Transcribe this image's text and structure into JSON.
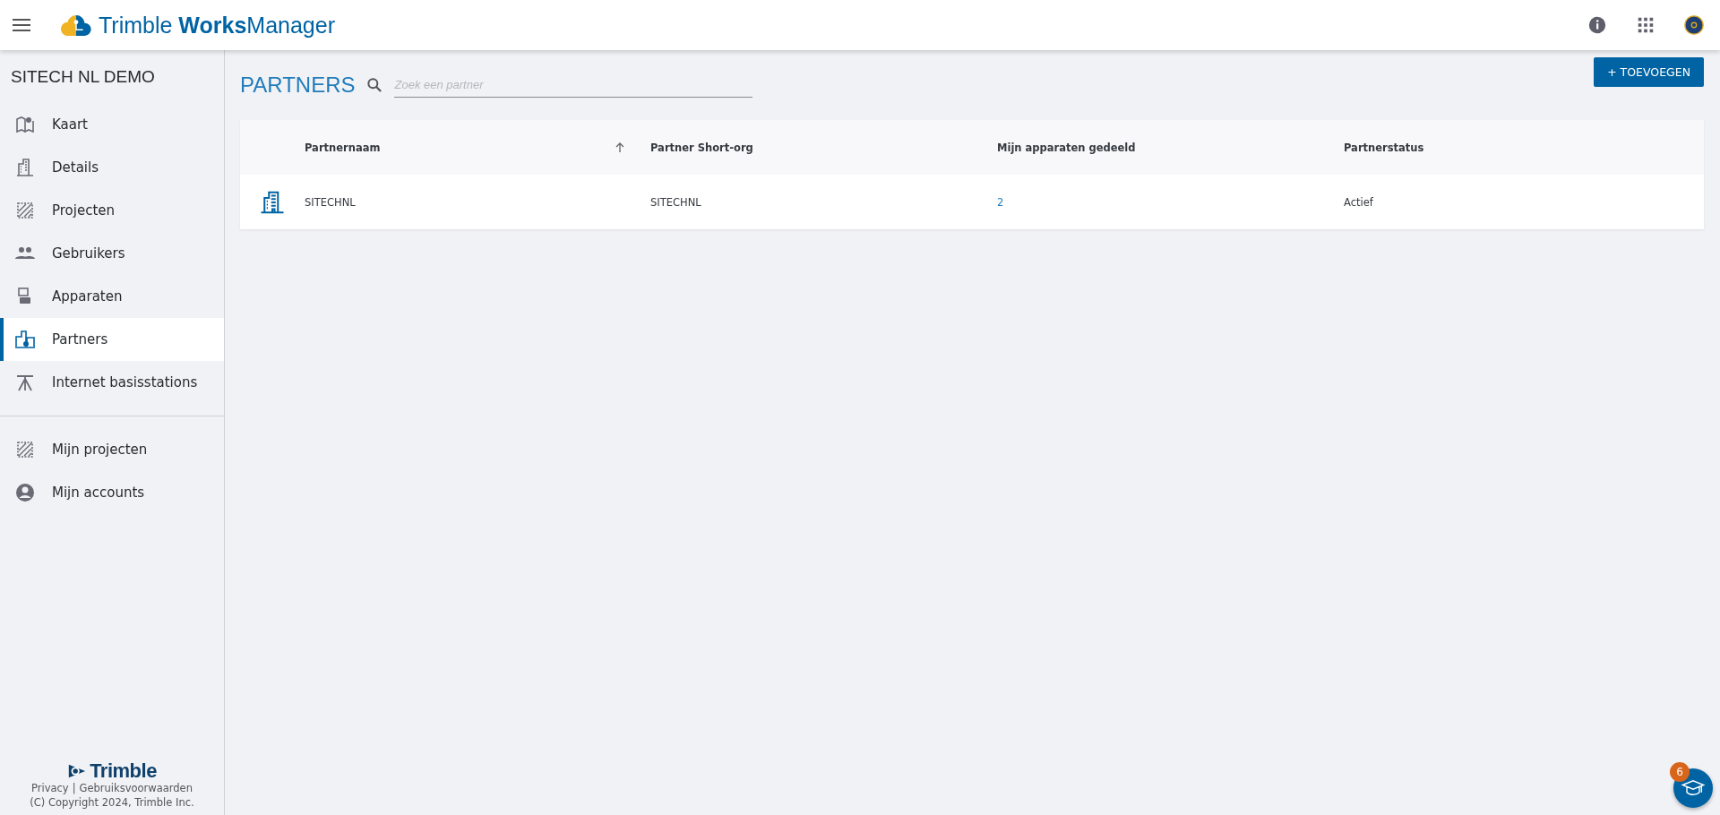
{
  "header": {
    "brand": "Trimble **Works**Manager"
  },
  "sidebar": {
    "org": "SITECH NL DEMO",
    "items": [
      {
        "label": "Kaart",
        "selected": false
      },
      {
        "label": "Details",
        "selected": false
      },
      {
        "label": "Projecten",
        "selected": false
      },
      {
        "label": "Gebruikers",
        "selected": false
      },
      {
        "label": "Apparaten",
        "selected": false
      },
      {
        "label": "Partners",
        "selected": true
      },
      {
        "label": "Internet basisstations",
        "selected": false
      }
    ],
    "personal_items": [
      {
        "label": "Mijn projecten",
        "selected": false
      },
      {
        "label": "Mijn accounts",
        "selected": false
      }
    ],
    "footer": {
      "logo": "Trimble",
      "privacy": "Privacy",
      "separator": "|",
      "terms": "Gebruiksvoorwaarden",
      "copyright": "(C) Copyright 2024, Trimble Inc."
    }
  },
  "page": {
    "title": "PARTNERS",
    "search": {
      "placeholder": "Zoek een partner"
    },
    "add_button": "+ TOEVOEGEN"
  },
  "table": {
    "columns": [
      {
        "label": "Partnernaam",
        "sorted": true
      },
      {
        "label": "Partner Short-org",
        "sorted": false
      },
      {
        "label": "Mijn apparaten gedeeld",
        "sorted": false
      },
      {
        "label": "Partnerstatus",
        "sorted": false
      }
    ],
    "rows": [
      {
        "name": "SITECHNL",
        "short_org": "SITECHNL",
        "shared_devices": "2",
        "status": "Actief"
      }
    ]
  },
  "help": {
    "badge": "6"
  }
}
